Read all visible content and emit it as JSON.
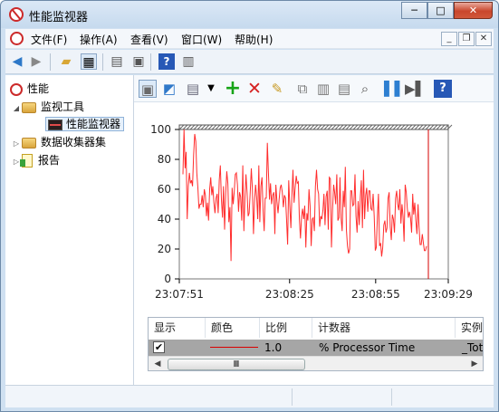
{
  "window": {
    "title": "性能监视器"
  },
  "menu": {
    "items": [
      "文件(F)",
      "操作(A)",
      "查看(V)",
      "窗口(W)",
      "帮助(H)"
    ]
  },
  "tree": {
    "root": "性能",
    "monitoring_tools": "监视工具",
    "performance_monitor": "性能监视器",
    "data_collector_sets": "数据收集器集",
    "reports": "报告"
  },
  "chart_data": {
    "type": "line",
    "ylim": [
      0,
      100
    ],
    "yticks": [
      "100",
      "80",
      "60",
      "40",
      "20",
      "0"
    ],
    "xtick_labels": [
      "23:07:51",
      "23:08:25",
      "23:08:55",
      "23:09:29"
    ],
    "series": [
      {
        "color": "#ff2d2d",
        "values": [
          70,
          100,
          74,
          85,
          40,
          62,
          71,
          64,
          66,
          62,
          83,
          97,
          92,
          71,
          61,
          47,
          50,
          50,
          56,
          48,
          60,
          56,
          42,
          51,
          39,
          60,
          68,
          56,
          62,
          51,
          44,
          54,
          57,
          44,
          66,
          76,
          53,
          41,
          62,
          33,
          57,
          72,
          64,
          38,
          48,
          12,
          61,
          50,
          58,
          70,
          71,
          63,
          45,
          58,
          55,
          39,
          76,
          32,
          53,
          70,
          58,
          42,
          44,
          58,
          74,
          60,
          30,
          51,
          63,
          55,
          40,
          76,
          38,
          62,
          68,
          46,
          32,
          54,
          54,
          91,
          71,
          53,
          64,
          50,
          56,
          58,
          30,
          63,
          52,
          44,
          53,
          61,
          63,
          58,
          48,
          56,
          54,
          40,
          23,
          66,
          49,
          34,
          56,
          73,
          51,
          61,
          69,
          64,
          65,
          40,
          27,
          42,
          47,
          40,
          49,
          21,
          44,
          39,
          60,
          49,
          22,
          40,
          41,
          32,
          62,
          73,
          60,
          57,
          35,
          42,
          40,
          46,
          57,
          36,
          55,
          59,
          33,
          68,
          67,
          21,
          46,
          63,
          58,
          50,
          70,
          39,
          41,
          68,
          41,
          32,
          59,
          48,
          75,
          33,
          22,
          17,
          20,
          59,
          59,
          49,
          50,
          70,
          42,
          31,
          52,
          36,
          55,
          66,
          34,
          73,
          40,
          56,
          61,
          45,
          59,
          59,
          47,
          46,
          57,
          42,
          19,
          21,
          41,
          57,
          22,
          24,
          15,
          21,
          36,
          39,
          31,
          34,
          54,
          58,
          35,
          26,
          43,
          40,
          31,
          54,
          59,
          50,
          46,
          60,
          37,
          50,
          42,
          25,
          63,
          58,
          47,
          41,
          45,
          41,
          31,
          57,
          43,
          51,
          39,
          30,
          50,
          35,
          23,
          23,
          30,
          24,
          19,
          19,
          22
        ]
      }
    ]
  },
  "counter_table": {
    "headers": [
      "显示",
      "颜色",
      "比例",
      "计数器",
      "实例"
    ],
    "row": {
      "checked": "✔",
      "scale": "1.0",
      "counter": "% Processor Time",
      "instance": "_Tot"
    },
    "scroll_thumb": "Ⅲ"
  },
  "icons": {
    "back": "back-icon",
    "forward": "forward-icon",
    "up": "up-folder-icon",
    "console_tree": "console-tree-icon",
    "export": "export-icon",
    "print": "print-icon",
    "help": "help-icon",
    "show_hide": "show-hide-icon",
    "change_graph": "change-graph-icon",
    "view_log": "view-log-icon",
    "add_counter": "add-counter-icon",
    "delete_counter": "delete-counter-icon",
    "highlight": "highlight-icon",
    "copy": "copy-icon",
    "paste": "paste-icon",
    "properties": "properties-icon",
    "zoom": "zoom-icon",
    "freeze": "freeze-icon",
    "update": "update-icon"
  }
}
